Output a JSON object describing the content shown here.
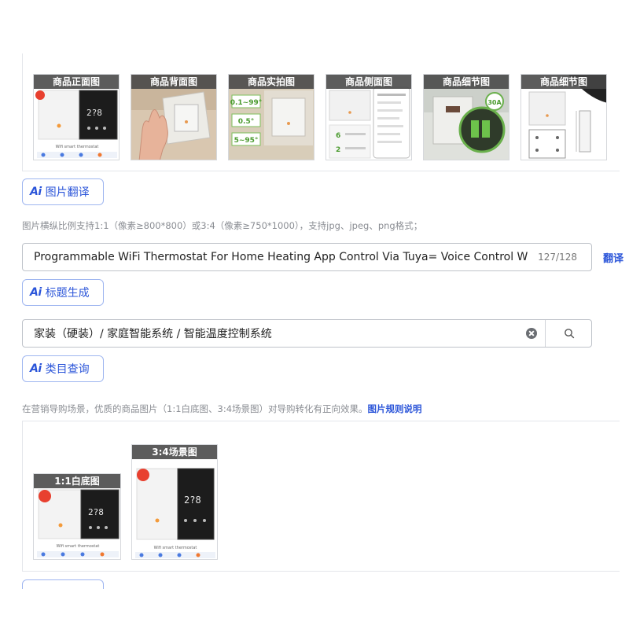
{
  "main_images": {
    "thumbnails": [
      {
        "label": "商品正面图",
        "icon": "thermostat-front-image"
      },
      {
        "label": "商品背面图",
        "icon": "hand-on-thermostat-image"
      },
      {
        "label": "商品实拍图",
        "icon": "thermostat-photo-image"
      },
      {
        "label": "商品侧面图",
        "icon": "thermostat-side-image"
      },
      {
        "label": "商品细节图",
        "icon": "thermostat-relay-detail-image"
      },
      {
        "label": "商品细节图",
        "icon": "thermostat-dimension-image"
      }
    ]
  },
  "image_translate": {
    "label": "图片翻译",
    "ai_mark": "Ai"
  },
  "image_requirements_text": "图片横纵比例支持1:1（像素≥800*800）或3:4（像素≥750*1000），支持jpg、jpeg、png格式；",
  "title": {
    "value": "Programmable WiFi Thermostat For Home Heating App Control Via Tuya= Voice Control W",
    "count": "127/128",
    "translate_label": "翻译"
  },
  "title_generate": {
    "label": "标题生成",
    "ai_mark": "Ai"
  },
  "category": {
    "value": "家装（硬装）/ 家庭智能系统 / 智能温度控制系统",
    "search_icon": "search-icon",
    "clear_icon": "clear-icon"
  },
  "category_query": {
    "label": "类目查询",
    "ai_mark": "Ai"
  },
  "marketing_hint": {
    "text": "在营销导购场景，优质的商品图片（1:1白底图、3:4场景图）对导购转化有正向效果。",
    "link": "图片规则说明"
  },
  "scene_images": {
    "white_background": {
      "label": "1:1白底图"
    },
    "scene": {
      "label": "3:4场景图"
    }
  },
  "thumbnail_text": {
    "product_caption": "Wifi smart thermostat",
    "reading_1": "0.1~99°",
    "reading_2": "0.5°",
    "reading_3": "5~95°",
    "relay": "30A"
  },
  "colors": {
    "accent": "#2b55d9",
    "border": "#bfc3ca",
    "label_bg": "#464646"
  }
}
